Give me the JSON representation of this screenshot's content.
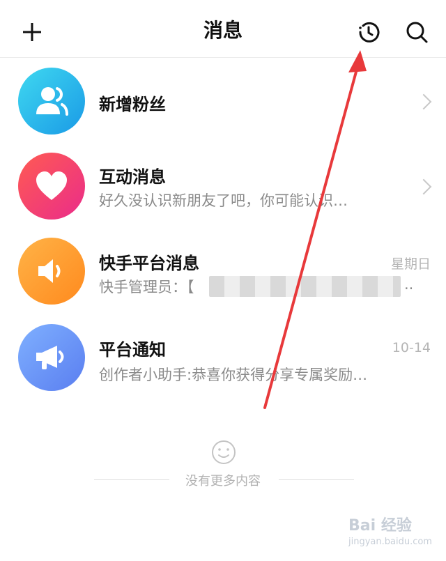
{
  "header": {
    "title": "消息",
    "add_icon": "plus-icon",
    "history_icon": "history-icon",
    "search_icon": "search-icon"
  },
  "rows": [
    {
      "title": "新增粉丝",
      "subtitle": "",
      "time": "",
      "icon": "followers-icon",
      "color": "#22c1e8"
    },
    {
      "title": "互动消息",
      "subtitle": "好久没认识新朋友了吧，你可能认识…",
      "time": "",
      "icon": "heart-icon",
      "color": "#f2386a"
    },
    {
      "title": "快手平台消息",
      "subtitle": "快手管理员：【",
      "subtitle_tail": "..",
      "time": "星期日",
      "icon": "speaker-icon",
      "color": "#ff9a2a"
    },
    {
      "title": "平台通知",
      "subtitle": "创作者小助手:恭喜你获得分享专属奖励…",
      "time": "10-14",
      "icon": "megaphone-icon",
      "color": "#5d8bf4"
    }
  ],
  "footer": {
    "text": "没有更多内容",
    "icon": "smile-icon"
  },
  "watermark": {
    "main": "Bai 经验",
    "sub": "jingyan.baidu.com"
  },
  "annotation": {
    "color": "#e8393b"
  }
}
